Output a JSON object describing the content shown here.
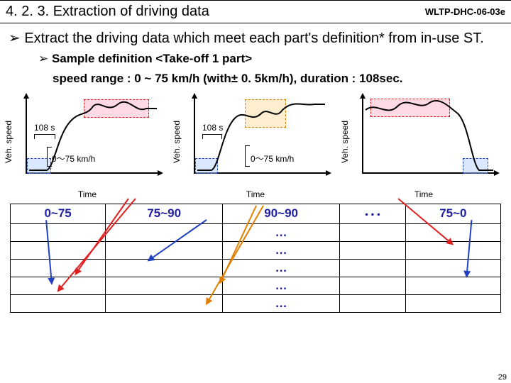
{
  "header": {
    "title": "4. 2. 3. Extraction of driving data",
    "docid": "WLTP-DHC-06-03e"
  },
  "body": {
    "line1": "Extract the driving data which meet each part's definition* from in-use ST.",
    "sub1": "Sample definition <Take-off 1 part>",
    "sub2": "speed range : 0 ~ 75 km/h (with± 0. 5km/h), duration : 108sec."
  },
  "graph": {
    "ylabel": "Veh. speed",
    "xlabel": "Time",
    "note108": "108 s",
    "noteRange": "0～75 km/h"
  },
  "table": {
    "cols": [
      "0~75",
      "75~90",
      "90~90",
      "･･･",
      "75~0"
    ],
    "dots": "…"
  },
  "pagenum": "29"
}
